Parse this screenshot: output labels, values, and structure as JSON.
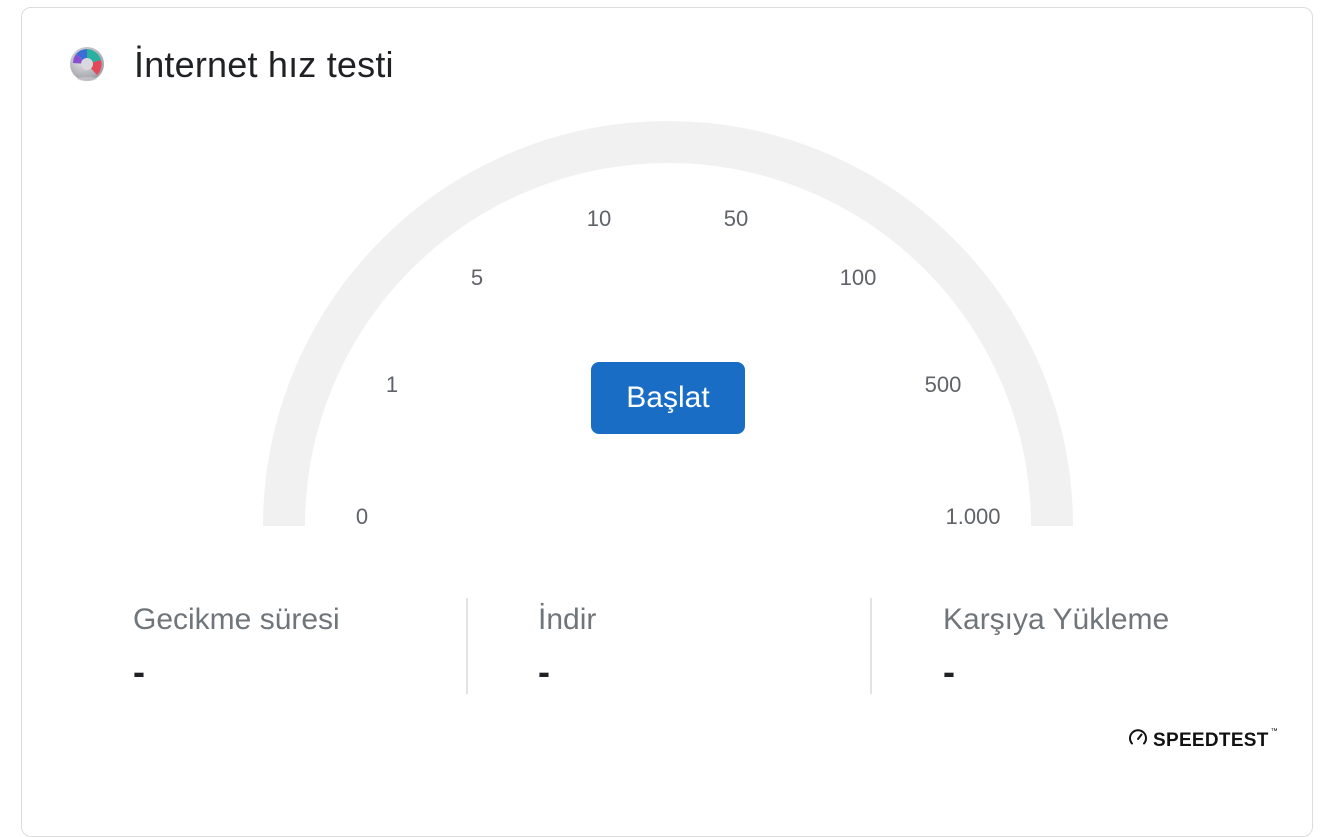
{
  "header": {
    "title": "İnternet hız testi",
    "logo_icon": "speed-test-app-icon"
  },
  "gauge": {
    "scale": "log-like",
    "ticks": [
      "0",
      "1",
      "5",
      "10",
      "50",
      "100",
      "500",
      "1.000"
    ],
    "track_color": "#f1f1f1"
  },
  "start_button": {
    "label": "Başlat",
    "color": "#1a6dc4"
  },
  "metrics": [
    {
      "label": "Gecikme süresi",
      "value": "-"
    },
    {
      "label": "İndir",
      "value": "-"
    },
    {
      "label": "Karşıya Yükleme",
      "value": "-"
    }
  ],
  "branding": {
    "name": "SPEEDTEST",
    "trademark": "™",
    "icon": "speedometer-icon"
  }
}
